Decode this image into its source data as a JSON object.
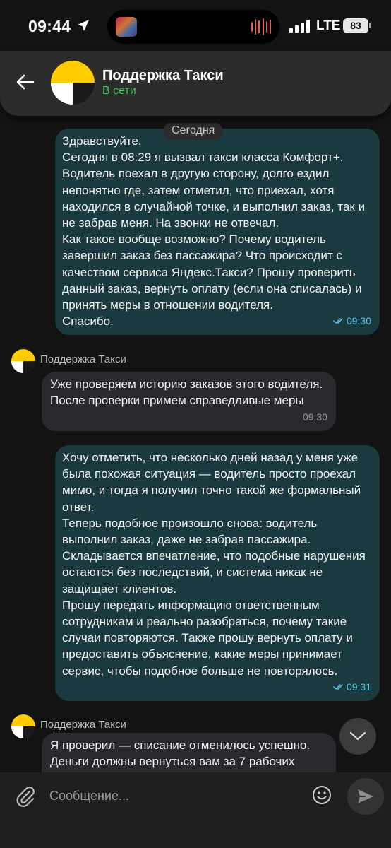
{
  "status_bar": {
    "time": "09:44",
    "carrier": "LTE",
    "battery": "83",
    "icons": [
      "location-arrow-icon",
      "signal-icon",
      "battery-icon"
    ]
  },
  "header": {
    "title": "Поддержка Такси",
    "status": "В сети",
    "status_color": "#43c463",
    "avatar": "yandex-taxi-logo"
  },
  "chat": {
    "date_separator": "Сегодня",
    "messages": [
      {
        "direction": "outgoing",
        "text": "Здравствуйте.\nСегодня в 08:29 я вызвал такси класса Комфорт+. Водитель поехал в другую сторону, долго ездил непонятно где, затем отметил, что приехал, хотя находился в случайной точке, и выполнил заказ, так и не забрав меня. На звонки не отвечал.\nКак такое вообще возможно? Почему водитель завершил заказ без пассажира? Что происходит с качеством сервиса Яндекс.Такси? Прошу проверить данный заказ, вернуть оплату (если она списалась) и принять меры в отношении водителя.\nСпасибо.",
        "time": "09:30",
        "read": true
      },
      {
        "direction": "incoming",
        "sender": "Поддержка Такси",
        "text": "Уже проверяем историю заказов этого водителя. После проверки примем справедливые меры",
        "time": "09:30"
      },
      {
        "direction": "outgoing",
        "text": "Хочу отметить, что несколько дней назад у меня уже была похожая ситуация — водитель просто проехал мимо, и тогда я получил точно такой же формальный ответ.\nТеперь подобное произошло снова: водитель выполнил заказ, даже не забрав пассажира. Складывается впечатление, что подобные нарушения остаются без последствий, и система никак не защищает клиентов.\nПрошу передать информацию ответственным сотрудникам и реально разобраться, почему такие случаи повторяются. Также прошу вернуть оплату и предоставить объяснение, какие меры принимает сервис, чтобы подобное больше не повторялось.",
        "time": "09:31",
        "read": true
      },
      {
        "direction": "incoming",
        "sender": "Поддержка Такси",
        "text": "Я проверил — списание отменилось успешно. Деньги должны вернуться вам за 7 рабочих"
      }
    ]
  },
  "composer": {
    "placeholder": "Сообщение...",
    "icons": [
      "paperclip-icon",
      "emoji-icon",
      "send-icon"
    ]
  },
  "colors": {
    "outgoing_bubble": "#1a3a40",
    "incoming_bubble": "#2a2a2e",
    "read_ticks": "#52c5dd",
    "logo_yellow": "#ffcc00"
  }
}
